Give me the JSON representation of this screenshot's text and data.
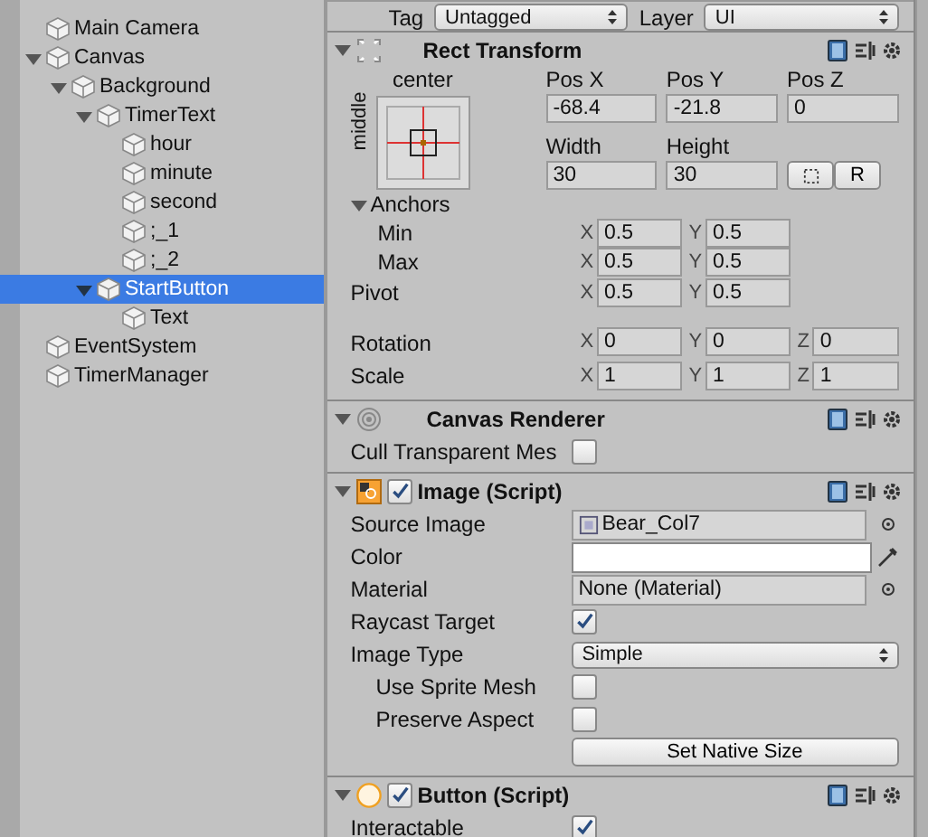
{
  "hierarchy": {
    "items": [
      {
        "name": "Main Camera",
        "selected": false
      },
      {
        "name": "Canvas",
        "selected": false,
        "expanded": true,
        "children": [
          {
            "name": "Background",
            "selected": false,
            "expanded": true,
            "children": [
              {
                "name": "TimerText",
                "selected": false,
                "expanded": true,
                "children": [
                  {
                    "name": "hour",
                    "selected": false
                  },
                  {
                    "name": "minute",
                    "selected": false
                  },
                  {
                    "name": "second",
                    "selected": false
                  },
                  {
                    "name": ";_1",
                    "selected": false
                  },
                  {
                    "name": ";_2",
                    "selected": false
                  }
                ]
              },
              {
                "name": "StartButton",
                "selected": true,
                "expanded": true,
                "children": [
                  {
                    "name": "Text",
                    "selected": false
                  }
                ]
              }
            ]
          }
        ]
      },
      {
        "name": "EventSystem",
        "selected": false
      },
      {
        "name": "TimerManager",
        "selected": false
      }
    ]
  },
  "inspector": {
    "tag": {
      "label": "Tag",
      "value": "Untagged"
    },
    "layer": {
      "label": "Layer",
      "value": "UI"
    },
    "rect_transform": {
      "title": "Rect Transform",
      "expanded": true,
      "anchor_horizontal": "center",
      "anchor_vertical": "middle",
      "fields": [
        {
          "label": "Pos X",
          "value": "-68.4"
        },
        {
          "label": "Pos Y",
          "value": "-21.8"
        },
        {
          "label": "Pos Z",
          "value": "0"
        },
        {
          "label": "Width",
          "value": "30"
        },
        {
          "label": "Height",
          "value": "30"
        }
      ],
      "raw_button": "R",
      "anchors": {
        "label": "Anchors",
        "expanded": true,
        "rows": [
          {
            "label": "Min",
            "values": [
              {
                "axis": "X",
                "value": "0.5"
              },
              {
                "axis": "Y",
                "value": "0.5"
              }
            ]
          },
          {
            "label": "Max",
            "values": [
              {
                "axis": "X",
                "value": "0.5"
              },
              {
                "axis": "Y",
                "value": "0.5"
              }
            ]
          }
        ]
      },
      "rows": [
        {
          "label": "Pivot",
          "values": [
            {
              "axis": "X",
              "value": "0.5"
            },
            {
              "axis": "Y",
              "value": "0.5"
            }
          ]
        },
        {
          "label": "Rotation",
          "values": [
            {
              "axis": "X",
              "value": "0"
            },
            {
              "axis": "Y",
              "value": "0"
            },
            {
              "axis": "Z",
              "value": "0"
            }
          ]
        },
        {
          "label": "Scale",
          "values": [
            {
              "axis": "X",
              "value": "1"
            },
            {
              "axis": "Y",
              "value": "1"
            },
            {
              "axis": "Z",
              "value": "1"
            }
          ]
        }
      ]
    },
    "components": [
      {
        "title": "Canvas Renderer",
        "expanded": true,
        "properties": [
          {
            "kind": "checkbox",
            "label": "Cull Transparent Mes",
            "checked": false,
            "indented": false
          }
        ]
      },
      {
        "title": "Image (Script)",
        "expanded": true,
        "enabled": true,
        "properties": [
          {
            "kind": "object",
            "label": "Source Image",
            "value": "Bear_Col7",
            "indented": false
          },
          {
            "kind": "color",
            "label": "Color",
            "color": "#ffffff",
            "indented": false
          },
          {
            "kind": "object",
            "label": "Material",
            "value": "None (Material)",
            "indented": false
          },
          {
            "kind": "checkbox",
            "label": "Raycast Target",
            "checked": true,
            "indented": false
          },
          {
            "kind": "dropdown",
            "label": "Image Type",
            "value": "Simple",
            "indented": false
          },
          {
            "kind": "checkbox",
            "label": "Use Sprite Mesh",
            "checked": false,
            "indented": true
          },
          {
            "kind": "checkbox",
            "label": "Preserve Aspect",
            "checked": false,
            "indented": true
          },
          {
            "kind": "button",
            "label": "Set Native Size",
            "indented": false
          }
        ]
      },
      {
        "title": "Button (Script)",
        "expanded": true,
        "enabled": true,
        "properties": [
          {
            "kind": "checkbox",
            "label": "Interactable",
            "checked": true,
            "indented": false
          }
        ]
      }
    ]
  }
}
